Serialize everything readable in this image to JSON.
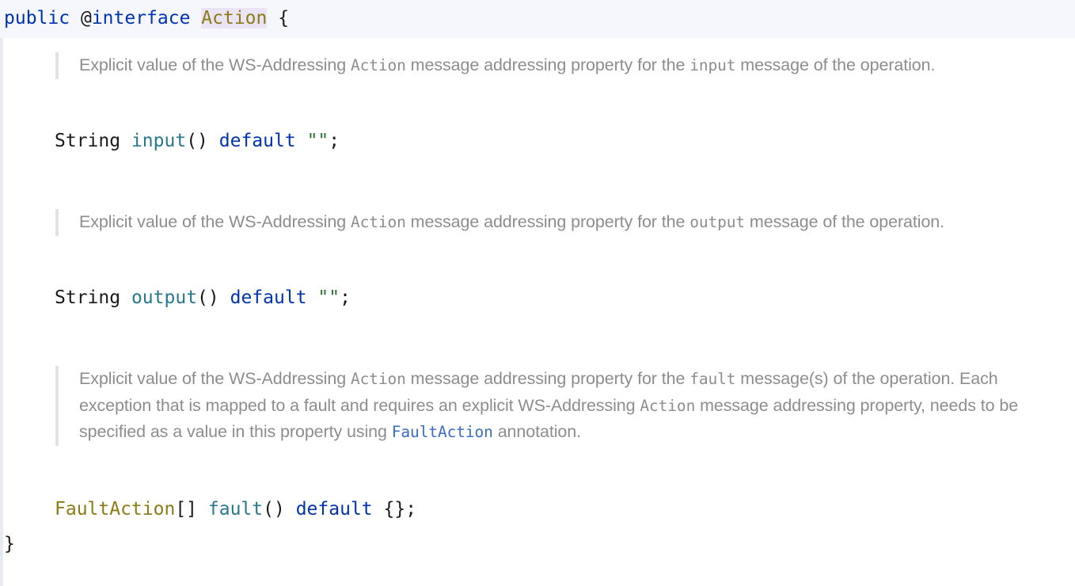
{
  "editor": {
    "language": "java",
    "colors": {
      "background": "#ffffff",
      "declaration_band": "#f5f7fd",
      "keyword": "#0033b3",
      "class_name": "#8c7b15",
      "method_name": "#27788c",
      "string_literal": "#2a7030",
      "doc_text": "#8d8d8d",
      "doc_link": "#3b6cc7",
      "identifier_highlight": "#ebe4f7",
      "quote_bar": "#e2e2e2",
      "left_rail": "#e9ebf3"
    }
  },
  "declaration": {
    "modifier": "public",
    "at_symbol": "@",
    "keyword": "interface",
    "type_name": "Action",
    "open_brace": "{"
  },
  "members": [
    {
      "id": "input",
      "doc": {
        "segments": [
          {
            "kind": "text",
            "value": "Explicit value of the WS-Addressing "
          },
          {
            "kind": "code",
            "value": "Action"
          },
          {
            "kind": "text",
            "value": " message addressing property for the "
          },
          {
            "kind": "code",
            "value": "input"
          },
          {
            "kind": "text",
            "value": " message of the operation."
          }
        ]
      },
      "signature": {
        "return_type": "String",
        "name": "input",
        "parens": "()",
        "default_keyword": "default",
        "default_value": "\"\"",
        "semicolon": ";"
      }
    },
    {
      "id": "output",
      "doc": {
        "segments": [
          {
            "kind": "text",
            "value": "Explicit value of the WS-Addressing "
          },
          {
            "kind": "code",
            "value": "Action"
          },
          {
            "kind": "text",
            "value": " message addressing property for the "
          },
          {
            "kind": "code",
            "value": "output"
          },
          {
            "kind": "text",
            "value": " message of the operation."
          }
        ]
      },
      "signature": {
        "return_type": "String",
        "name": "output",
        "parens": "()",
        "default_keyword": "default",
        "default_value": "\"\"",
        "semicolon": ";"
      }
    },
    {
      "id": "fault",
      "doc": {
        "segments": [
          {
            "kind": "text",
            "value": "Explicit value of the WS-Addressing "
          },
          {
            "kind": "code",
            "value": "Action"
          },
          {
            "kind": "text",
            "value": " message addressing property for the "
          },
          {
            "kind": "code",
            "value": "fault"
          },
          {
            "kind": "text",
            "value": " message(s) of the operation. Each exception that is mapped to a fault and requires an explicit WS-Addressing "
          },
          {
            "kind": "code",
            "value": "Action"
          },
          {
            "kind": "text",
            "value": " message addressing property, needs to be specified as a value in this property using "
          },
          {
            "kind": "link",
            "value": "FaultAction"
          },
          {
            "kind": "text",
            "value": " annotation."
          }
        ]
      },
      "signature": {
        "return_type": "FaultAction",
        "array_brackets": "[]",
        "name": "fault",
        "parens": "()",
        "default_keyword": "default",
        "default_value": "{}",
        "semicolon": ";"
      }
    }
  ],
  "closing_brace": "}"
}
